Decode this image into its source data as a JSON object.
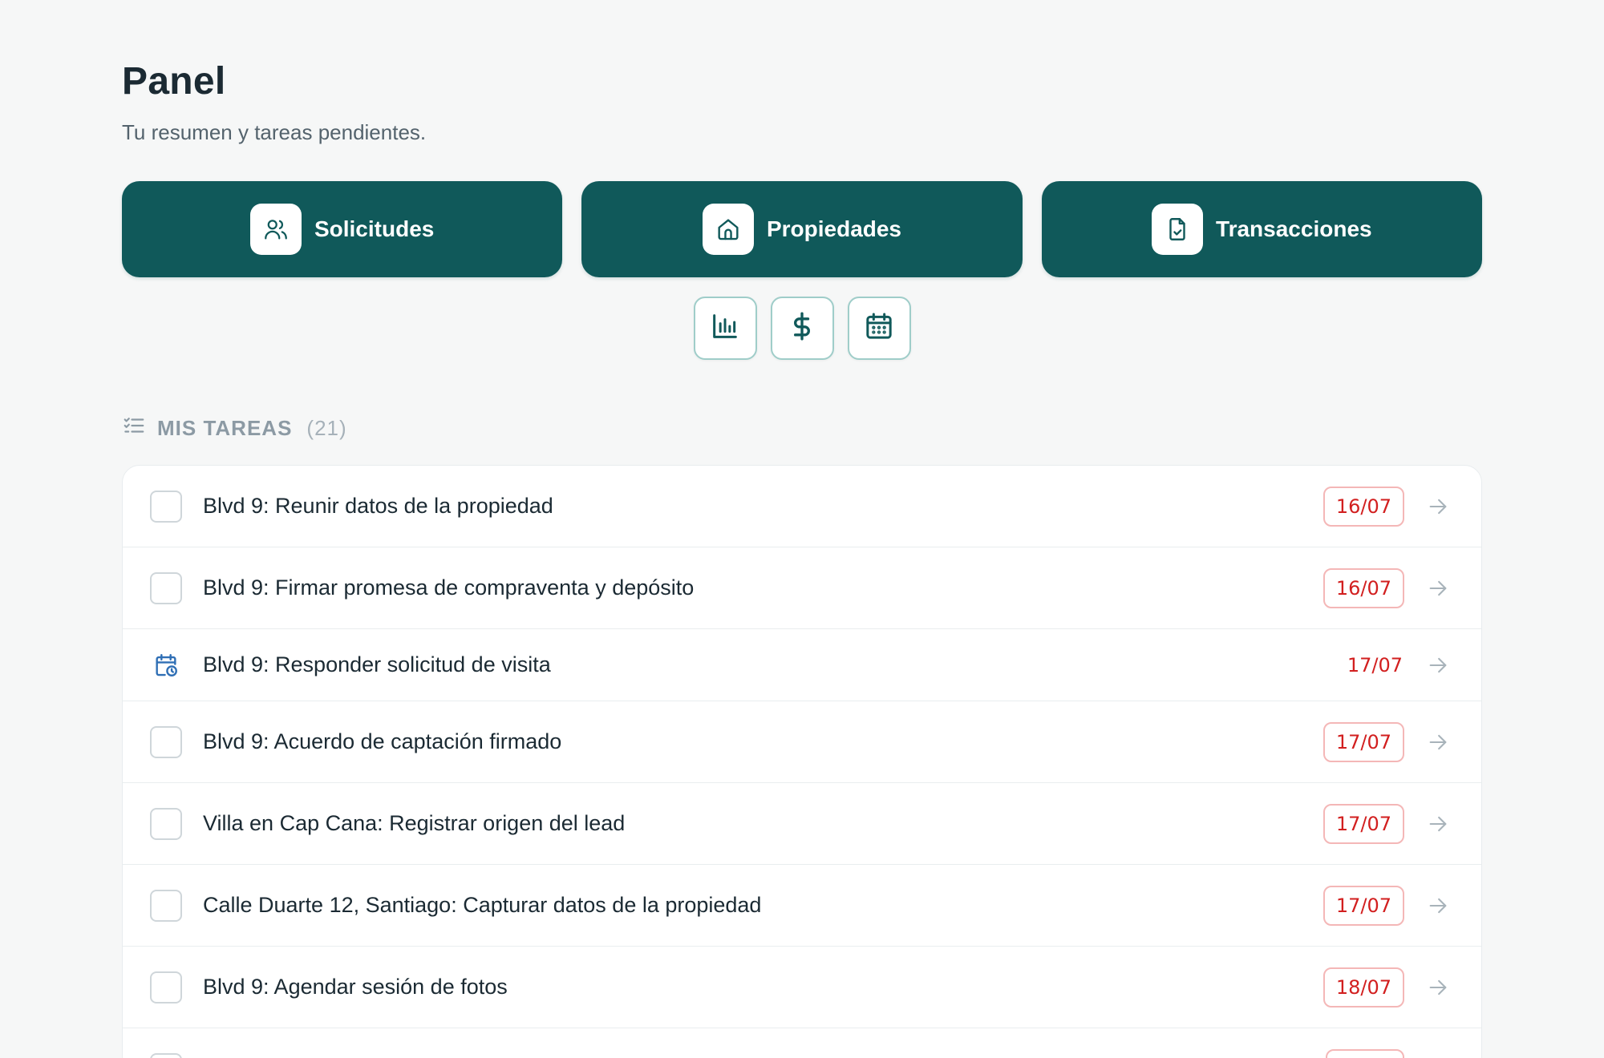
{
  "header": {
    "title": "Panel",
    "subtitle": "Tu resumen y tareas pendientes."
  },
  "nav_cards": [
    {
      "label": "Solicitudes",
      "icon": "users-icon"
    },
    {
      "label": "Propiedades",
      "icon": "house-icon"
    },
    {
      "label": "Transacciones",
      "icon": "document-check-icon"
    }
  ],
  "quick_actions": [
    {
      "icon": "bar-chart-icon"
    },
    {
      "icon": "dollar-icon"
    },
    {
      "icon": "calendar-icon"
    }
  ],
  "tasks": {
    "heading": "MIS TAREAS",
    "count": "(21)",
    "items": [
      {
        "title": "Blvd 9: Reunir datos de la propiedad",
        "date": "16/07",
        "kind": "checkbox"
      },
      {
        "title": "Blvd 9: Firmar promesa de compraventa y depósito",
        "date": "16/07",
        "kind": "checkbox"
      },
      {
        "title": "Blvd 9: Responder solicitud de visita",
        "date": "17/07",
        "kind": "calendar-clock-icon"
      },
      {
        "title": "Blvd 9: Acuerdo de captación firmado",
        "date": "17/07",
        "kind": "checkbox"
      },
      {
        "title": "Villa en Cap Cana: Registrar origen del lead",
        "date": "17/07",
        "kind": "checkbox"
      },
      {
        "title": "Calle Duarte 12, Santiago: Capturar datos de la propiedad",
        "date": "17/07",
        "kind": "checkbox"
      },
      {
        "title": "Blvd 9: Agendar sesión de fotos",
        "date": "18/07",
        "kind": "checkbox"
      }
    ]
  },
  "colors": {
    "brand": "#10595a",
    "due_date_red": "#d21f1f",
    "due_date_border": "#f4b7b7",
    "page_bg": "#f6f7f7"
  }
}
